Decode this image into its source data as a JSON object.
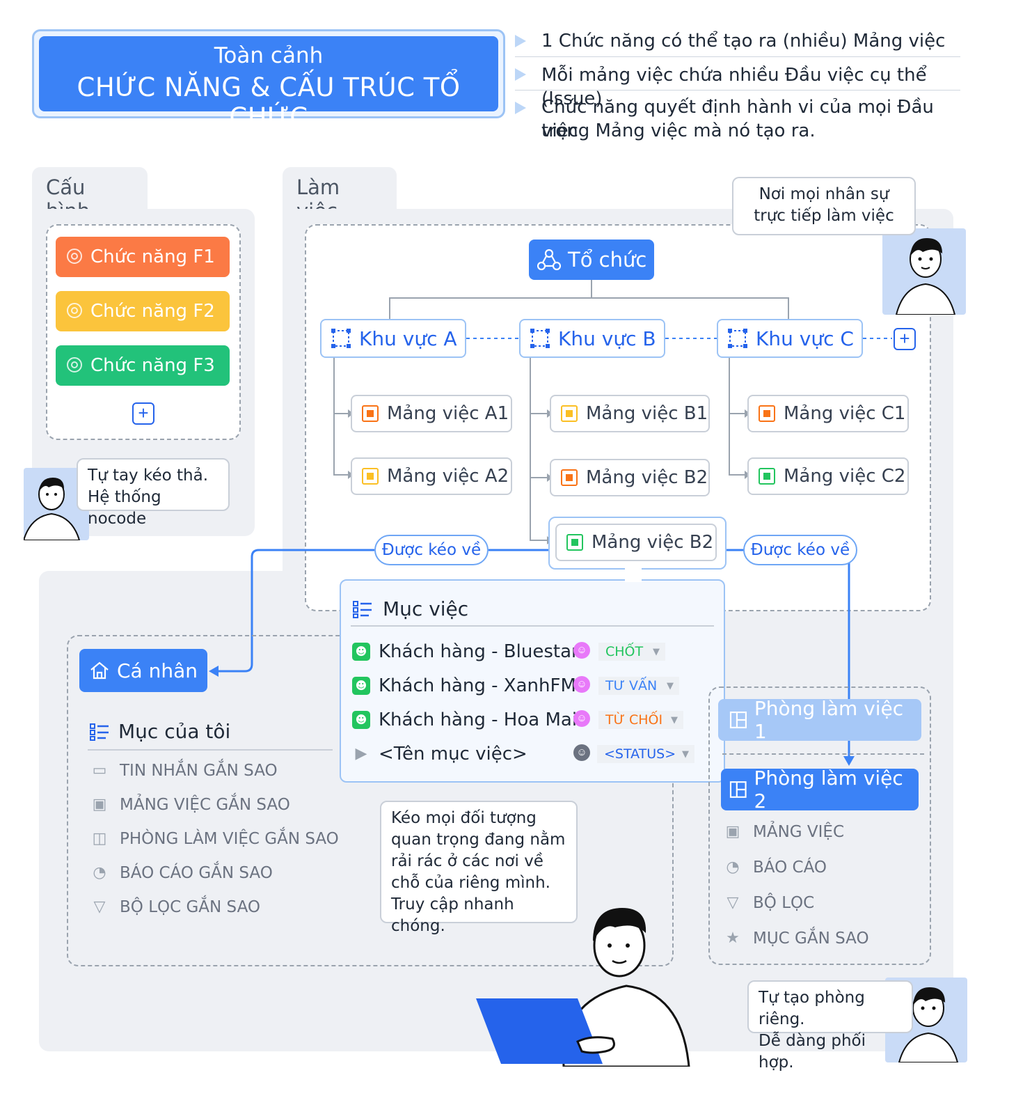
{
  "header": {
    "subtitle": "Toàn cảnh",
    "title": "CHỨC NĂNG & CẤU TRÚC TỔ CHỨC",
    "bullets": [
      "1 Chức năng có thể tạo ra (nhiều) Mảng việc",
      "Mỗi mảng việc chứa nhiều Đầu việc cụ thể (Issue)",
      "Chức năng quyết định hành vi của mọi Đầu việc",
      "trong Mảng việc mà nó tạo ra."
    ]
  },
  "config": {
    "tab": "Cấu hình",
    "functions": [
      "Chức năng F1",
      "Chức năng F2",
      "Chức năng F3"
    ],
    "bubble": [
      "Tự tay kéo thả.",
      "Hệ thống nocode"
    ]
  },
  "working": {
    "tab": "Làm việc",
    "bubble": [
      "Nơi mọi nhân sự",
      "trực tiếp làm việc"
    ],
    "org": "Tổ chức",
    "areas": [
      "Khu vực A",
      "Khu vực B",
      "Khu vực C"
    ],
    "workstreams": {
      "a1": "Mảng việc A1",
      "a2": "Mảng việc A2",
      "b1": "Mảng việc B1",
      "b2": "Mảng việc B2",
      "c1": "Mảng việc C1",
      "c2": "Mảng việc C2",
      "b2_selected": "Mảng việc B2"
    },
    "pulled_left": "Được kéo về",
    "pulled_right": "Được kéo về"
  },
  "items": {
    "title": "Mục việc",
    "rows": [
      {
        "name": "Khách hàng - Bluestar",
        "status": "CHỐT"
      },
      {
        "name": "Khách hàng - XanhFM",
        "status": "TƯ VẤN"
      },
      {
        "name": "Khách hàng - Hoa Mai",
        "status": "TỪ CHỐI"
      },
      {
        "name": "<Tên mục việc>",
        "status": "<STATUS>"
      }
    ],
    "status_colors": {
      "chot": "#22c55e",
      "tuvan": "#3b82f6",
      "tuchoi": "#f97316",
      "generic": "#2563eb"
    }
  },
  "personal": {
    "button": "Cá nhân",
    "title": "Mục của tôi",
    "menu": [
      "TIN NHẮN GẮN SAO",
      "MẢNG VIỆC GẮN SAO",
      "PHÒNG LÀM VIỆC GẮN SAO",
      "BÁO CÁO GẮN SAO",
      "BỘ LỌC GẮN SAO"
    ],
    "bubble": [
      "Kéo mọi đối tượng",
      "quan trọng đang nằm",
      "rải rác ở các nơi về",
      "chỗ của riêng mình.",
      "Truy cập nhanh chóng."
    ]
  },
  "rooms": {
    "room1": "Phòng làm việc 1",
    "room2": "Phòng làm việc 2",
    "menu": [
      "MẢNG VIỆC",
      "BÁO CÁO",
      "BỘ LỌC",
      "MỤC GẮN SAO"
    ],
    "bubble": [
      "Tự tạo phòng riêng.",
      "Dễ dàng phối hợp."
    ]
  },
  "colors": {
    "primary": "#3b82f6",
    "f1": "#fb7a45",
    "f2": "#fbc43c",
    "f3": "#22c27a"
  }
}
